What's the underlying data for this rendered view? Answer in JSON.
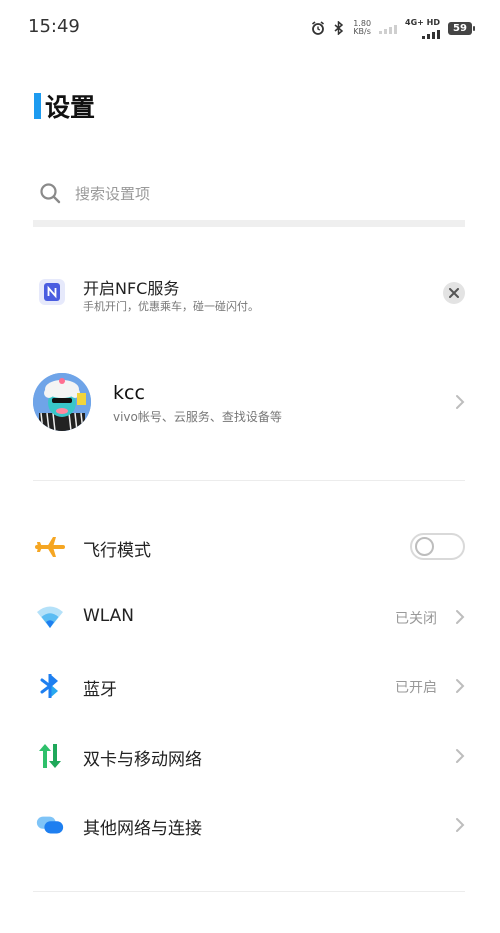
{
  "status_bar": {
    "time": "15:49",
    "speed_value": "1.80",
    "speed_unit": "KB/s",
    "network": "4G+ HD",
    "battery": "59"
  },
  "page": {
    "title": "设置"
  },
  "search": {
    "placeholder": "搜索设置项"
  },
  "nfc_card": {
    "title": "开启NFC服务",
    "subtitle": "手机开门，优惠乘车，碰一碰闪付。"
  },
  "account": {
    "name": "kcc",
    "subtitle": "vivo帐号、云服务、查找设备等"
  },
  "settings": {
    "airplane": {
      "label": "飞行模式",
      "enabled": false
    },
    "wlan": {
      "label": "WLAN",
      "value": "已关闭"
    },
    "bluetooth": {
      "label": "蓝牙",
      "value": "已开启"
    },
    "mobile": {
      "label": "双卡与移动网络"
    },
    "other": {
      "label": "其他网络与连接"
    }
  },
  "colors": {
    "accent": "#1d9bf0",
    "airplane": "#f5a623",
    "wifi": "#29a8ef",
    "bluetooth": "#1e7ff0",
    "mobile": "#2ec06b",
    "other": "#1e7ff0"
  }
}
